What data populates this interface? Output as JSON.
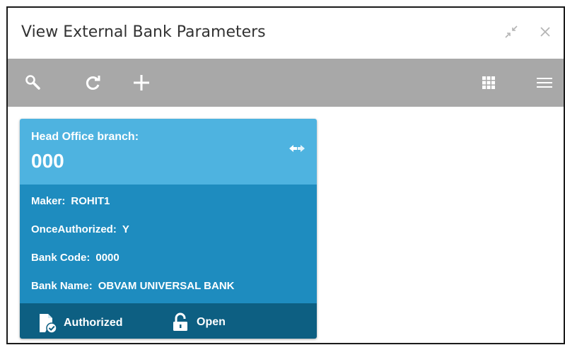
{
  "window": {
    "title": "View External Bank Parameters"
  },
  "toolbar": {
    "icons": [
      "search-icon",
      "refresh-icon",
      "add-icon",
      "grid-view-icon",
      "list-menu-icon"
    ]
  },
  "card": {
    "head_label": "Head Office branch:",
    "head_value": "000",
    "fields": [
      {
        "label": "Maker",
        "value": "ROHIT1"
      },
      {
        "label": "OnceAuthorized",
        "value": "Y"
      },
      {
        "label": "Bank Code",
        "value": "0000"
      },
      {
        "label": "Bank Name",
        "value": "OBVAM UNIVERSAL BANK"
      }
    ],
    "footer": {
      "auth_status": "Authorized",
      "record_status": "Open"
    }
  },
  "colors": {
    "toolbar_bg": "#a8a8a8",
    "card_head": "#4eb3e0",
    "card_body": "#1e8cbf",
    "card_footer": "#0d5f82"
  }
}
